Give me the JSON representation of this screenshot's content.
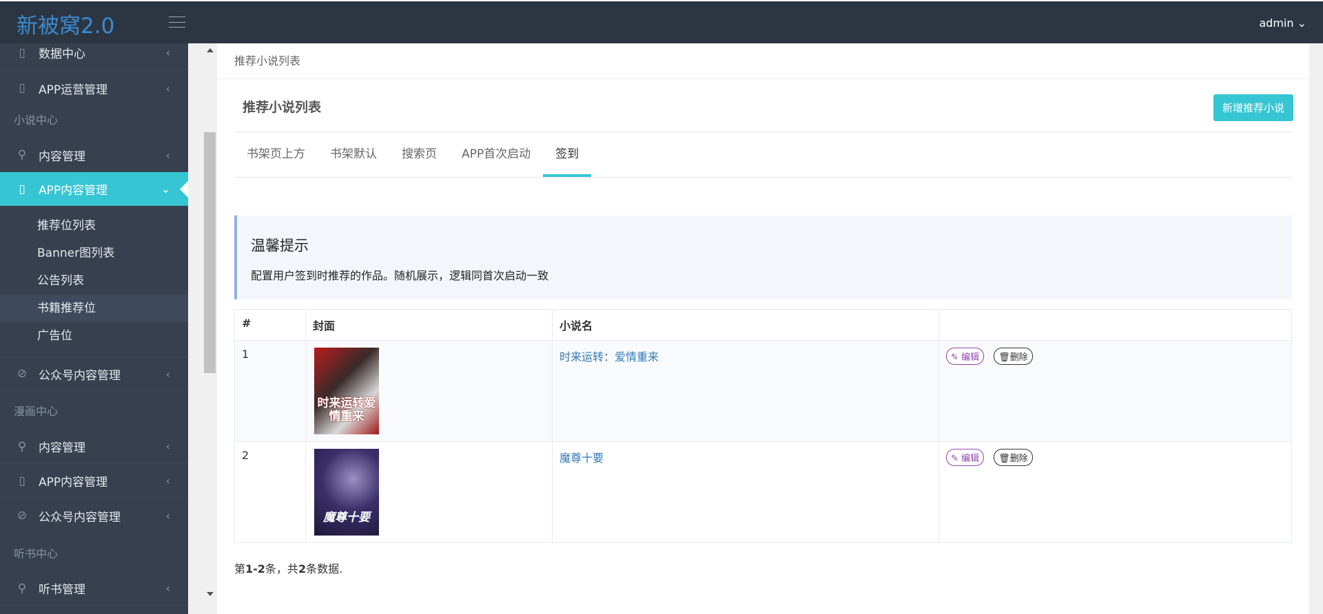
{
  "header": {
    "logo": "新被窝2.0",
    "user": "admin",
    "user_caret": "⌄"
  },
  "sidebar": {
    "items": [
      {
        "label": "数据中心",
        "icon": "▯"
      },
      {
        "label": "APP运营管理",
        "icon": "▯"
      },
      {
        "section": "小说中心"
      },
      {
        "label": "内容管理",
        "icon": "⚲"
      },
      {
        "label": "APP内容管理",
        "icon": "▯"
      },
      {
        "label": "公众号内容管理",
        "icon": "⊘"
      },
      {
        "section": "漫画中心"
      },
      {
        "label": "内容管理",
        "icon": "⚲"
      },
      {
        "label": "APP内容管理",
        "icon": "▯"
      },
      {
        "label": "公众号内容管理",
        "icon": "⊘"
      },
      {
        "section": "听书中心"
      },
      {
        "label": "听书管理",
        "icon": "⚲"
      }
    ],
    "subitems": [
      "推荐位列表",
      "Banner图列表",
      "公告列表",
      "书籍推荐位",
      "广告位"
    ],
    "chev": "‹",
    "chev_open": "⌄"
  },
  "breadcrumb": "推荐小说列表",
  "page": {
    "title": "推荐小说列表",
    "add_button": "新增推荐小说"
  },
  "tabs": [
    "书架页上方",
    "书架默认",
    "搜索页",
    "APP首次启动",
    "签到"
  ],
  "alert": {
    "title": "温馨提示",
    "text": "配置用户签到时推荐的作品。随机展示，逻辑同首次启动一致"
  },
  "table": {
    "headers": [
      "#",
      "封面",
      "小说名",
      ""
    ],
    "rows": [
      {
        "num": "1",
        "name": "时来运转：爱情重来",
        "cover_text": "时来运转爱情重来",
        "edit": "编辑",
        "delete": "删除"
      },
      {
        "num": "2",
        "name": "魔尊十要",
        "cover_text": "魔尊十要",
        "edit": "编辑",
        "delete": "删除"
      }
    ]
  },
  "summary": {
    "p1": "第",
    "range": "1-2",
    "p2": "条，共",
    "total": "2",
    "p3": "条数据."
  },
  "colors": {
    "accent": "#36c6d3",
    "sidebar": "#36404e",
    "header": "#2c3643"
  }
}
